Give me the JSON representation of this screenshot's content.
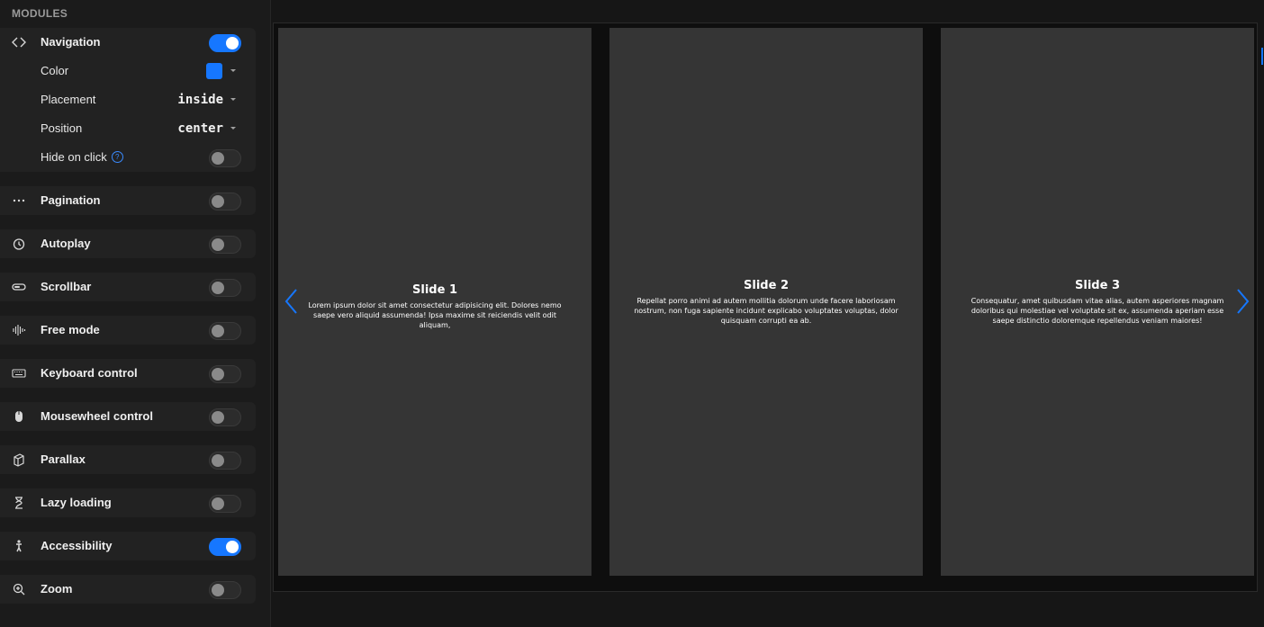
{
  "sidebar": {
    "title": "MODULES",
    "navigation": {
      "label": "Navigation",
      "enabled": true,
      "color_label": "Color",
      "color_value": "#1677ff",
      "placement_label": "Placement",
      "placement_value": "inside",
      "position_label": "Position",
      "position_value": "center",
      "hide_label": "Hide on click",
      "hide_enabled": false
    },
    "modules": [
      {
        "label": "Pagination",
        "icon": "dots-icon",
        "enabled": false
      },
      {
        "label": "Autoplay",
        "icon": "timer-icon",
        "enabled": false
      },
      {
        "label": "Scrollbar",
        "icon": "scrollbar-icon",
        "enabled": false
      },
      {
        "label": "Free mode",
        "icon": "sound-wave-icon",
        "enabled": false
      },
      {
        "label": "Keyboard control",
        "icon": "keyboard-icon",
        "enabled": false
      },
      {
        "label": "Mousewheel control",
        "icon": "mouse-icon",
        "enabled": false
      },
      {
        "label": "Parallax",
        "icon": "parallax-icon",
        "enabled": false
      },
      {
        "label": "Lazy loading",
        "icon": "hourglass-icon",
        "enabled": false
      },
      {
        "label": "Accessibility",
        "icon": "accessibility-icon",
        "enabled": true
      },
      {
        "label": "Zoom",
        "icon": "zoom-icon",
        "enabled": false
      }
    ]
  },
  "slides": [
    {
      "title": "Slide 1",
      "text": "Lorem ipsum dolor sit amet consectetur adipisicing elit. Dolores nemo saepe vero aliquid assumenda! Ipsa maxime sit reiciendis velit odit aliquam,"
    },
    {
      "title": "Slide 2",
      "text": "Repellat porro animi ad autem mollitia dolorum unde facere laboriosam nostrum, non fuga sapiente incidunt explicabo voluptates voluptas, dolor quisquam corrupti ea ab."
    },
    {
      "title": "Slide 3",
      "text": "Consequatur, amet quibusdam vitae alias, autem asperiores magnam doloribus qui molestiae vel voluptate sit ex, assumenda aperiam esse saepe distinctio doloremque repellendus veniam maiores!"
    }
  ],
  "colors": {
    "accent": "#1677ff"
  }
}
